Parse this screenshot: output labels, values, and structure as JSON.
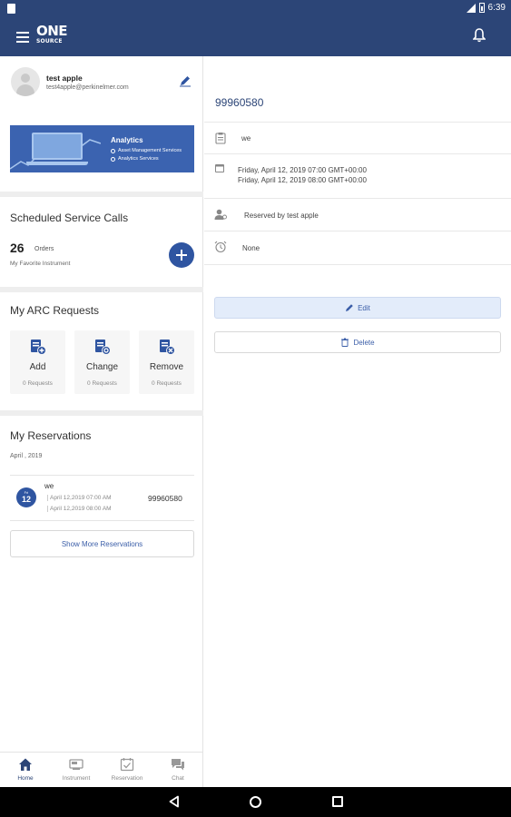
{
  "statusbar": {
    "time": "6:39"
  },
  "appbar": {
    "logo_top": "ONE",
    "logo_bottom": "SOURCE"
  },
  "profile": {
    "name": "test apple",
    "email": "test4apple@perkinelmer.com"
  },
  "banner": {
    "title": "Analytics",
    "line1": "Asset Management Services",
    "line2": "Analytics Services"
  },
  "scheduled": {
    "title": "Scheduled Service Calls",
    "count": "26",
    "count_label": "Orders",
    "subtitle": "My Favorite Instrument"
  },
  "arc": {
    "title": "My ARC Requests",
    "cards": [
      {
        "label": "Add",
        "sub": "0 Requests"
      },
      {
        "label": "Change",
        "sub": "0 Requests"
      },
      {
        "label": "Remove",
        "sub": "0 Requests"
      }
    ]
  },
  "reservations": {
    "title": "My Reservations",
    "month": "April , 2019",
    "item": {
      "badge_month": "Fri",
      "badge_day": "12",
      "name": "we",
      "start": "April 12,2019 07:00 AM",
      "end": "April 12,2019 08:00 AM",
      "id": "99960580"
    },
    "show_more": "Show More Reservations"
  },
  "bottomnav": {
    "items": [
      "Home",
      "Instrument",
      "Reservation",
      "Chat"
    ],
    "active": "Home"
  },
  "detail": {
    "id": "99960580",
    "name": "we",
    "start": "Friday, April 12, 2019 07:00 GMT+00:00",
    "end": "Friday, April 12, 2019 08:00 GMT+00:00",
    "reserved_by": "Reserved by test apple",
    "reminder": "None",
    "edit_label": "Edit",
    "delete_label": "Delete"
  },
  "colors": {
    "primary": "#2c4577",
    "accent": "#2f55a1",
    "edit_bg": "#e3ecfa"
  },
  "icons": {
    "appbar": [
      "menu-icon",
      "bell-icon"
    ],
    "detail": [
      "clipboard-icon",
      "calendar-icon",
      "person-icon",
      "alarm-icon",
      "pencil-icon",
      "trash-icon"
    ]
  }
}
